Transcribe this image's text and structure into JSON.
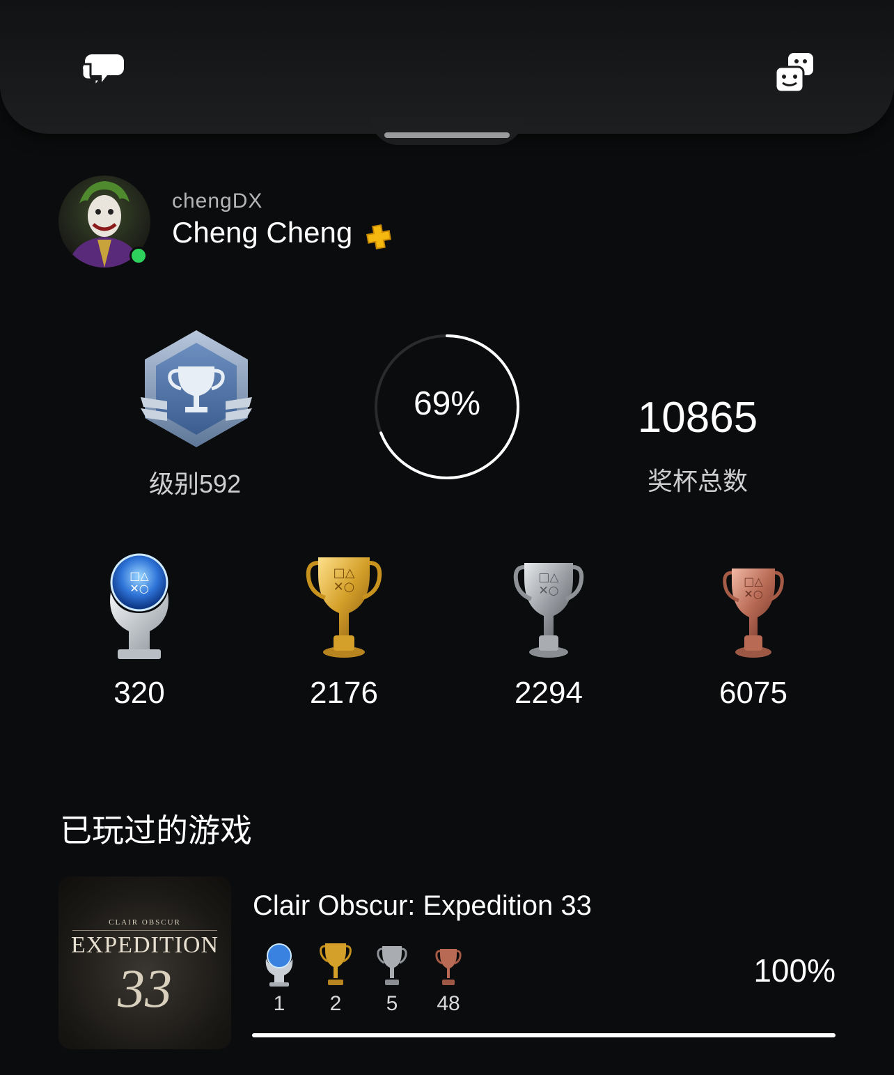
{
  "header": {
    "left_icon": "chat-bubbles-icon",
    "right_icon": "game-pieces-icon"
  },
  "profile": {
    "online_id": "chengDX",
    "display_name": "Cheng Cheng",
    "status": "online",
    "plus_icon": "ps-plus-icon"
  },
  "stats": {
    "level_label": "级别592",
    "progress_text": "69%",
    "progress_value": 0.69,
    "total_trophies": "10865",
    "total_label": "奖杯总数"
  },
  "trophies": {
    "platinum": "320",
    "gold": "2176",
    "silver": "2294",
    "bronze": "6075"
  },
  "games_section": {
    "title": "已玩过的游戏",
    "games": [
      {
        "title": "Clair Obscur: Expedition 33",
        "cover_top": "CLAIR OBSCUR",
        "cover_title": "EXPEDITION",
        "cover_number": "33",
        "platinum": "1",
        "gold": "2",
        "silver": "5",
        "bronze": "48",
        "progress_text": "100%",
        "progress_value": 1.0
      }
    ]
  },
  "colors": {
    "background": "#0b0c0d",
    "online": "#2ed15c",
    "plus": "#f5b80e",
    "gold": "#d4a02a",
    "silver": "#a9adb2",
    "bronze": "#b86a55",
    "platinum": "#4aa3ff"
  }
}
